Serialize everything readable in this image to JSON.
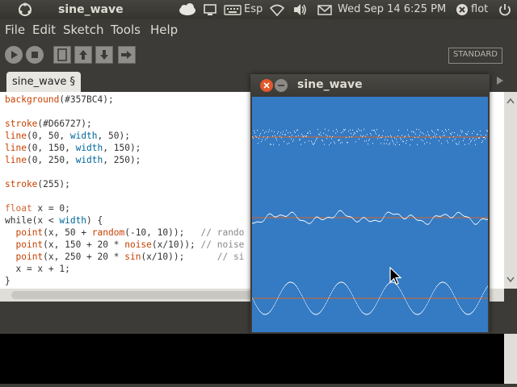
{
  "panel": {
    "app_title": "sine_wave",
    "keyboard_layout": "Esp",
    "clock": "Wed Sep 14  6:25 PM",
    "user": "flot"
  },
  "menu": {
    "file": "File",
    "edit": "Edit",
    "sketch": "Sketch",
    "tools": "Tools",
    "help": "Help"
  },
  "toolbar": {
    "mode": "STANDARD"
  },
  "tab": {
    "label": "sine_wave §"
  },
  "code_lines": [
    "background(#357BC4);",
    "",
    "stroke(#D66727);",
    "line(0, 50, width, 50);",
    "line(0, 150, width, 150);",
    "line(0, 250, width, 250);",
    "",
    "stroke(255);",
    "",
    "float x = 0;",
    "while(x < width) {",
    "  point(x, 50 + random(-10, 10));   // rando",
    "  point(x, 150 + 20 * noise(x/10)); // noise",
    "  point(x, 250 + 20 * sin(x/10));      // si",
    "  x = x + 1;",
    "}"
  ],
  "sketch_window": {
    "title": "sine_wave",
    "background": "#357BC4",
    "line_color": "#D66727"
  },
  "icons": [
    "ubuntu-logo-icon",
    "weather-icon",
    "display-icon",
    "keyboard-icon",
    "wifi-icon",
    "volume-icon",
    "mail-icon",
    "close-session-icon",
    "power-icon",
    "run-icon",
    "stop-icon",
    "new-icon",
    "open-icon",
    "save-icon",
    "export-icon",
    "tab-arrow-icon"
  ]
}
